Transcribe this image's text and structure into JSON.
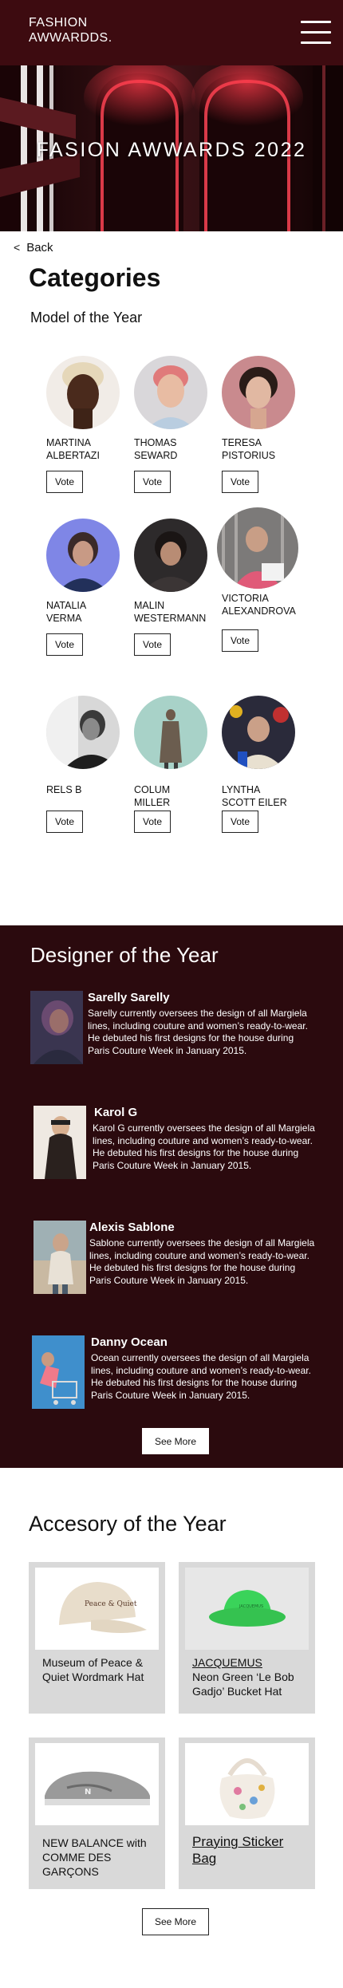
{
  "brand": {
    "line1": "FASHION",
    "line2": "AWWARDDS."
  },
  "hero": {
    "title": "FASION AWWARDS 2022"
  },
  "nav": {
    "back_label": "Back"
  },
  "page": {
    "title": "Categories"
  },
  "models": {
    "heading": "Model of the Year",
    "vote_label": "Vote",
    "items": [
      {
        "name": "MARTINA\nALBERTAZI"
      },
      {
        "name": "THOMAS\nSEWARD"
      },
      {
        "name": "TERESA\nPISTORIUS"
      },
      {
        "name": "NATALIA\nVERMA"
      },
      {
        "name": "MALIN\nWESTERMANN"
      },
      {
        "name": "VICTORIA\nALEXANDROVA"
      },
      {
        "name": "RELS B"
      },
      {
        "name": "COLUM\nMILLER"
      },
      {
        "name": "LYNTHA\nSCOTT EILER"
      }
    ]
  },
  "designers": {
    "heading": "Designer of the Year",
    "see_more": "See More",
    "items": [
      {
        "name": "Sarelly Sarelly",
        "desc": "Sarelly currently oversees the design of all Margiela lines, including couture and women’s ready-to-wear. He debuted his first designs for the house during Paris Couture Week in January 2015."
      },
      {
        "name": "Karol G",
        "desc": "Karol G currently oversees the design of all Margiela lines, including couture and women’s ready-to-wear. He debuted his first designs for the house during Paris Couture Week in January 2015."
      },
      {
        "name": "Alexis Sablone",
        "desc": "Sablone currently oversees the design of all Margiela lines, including couture and women’s ready-to-wear. He debuted his first designs for the house during Paris Couture Week in January 2015."
      },
      {
        "name": "Danny Ocean",
        "desc": "Ocean currently oversees the design of all Margiela lines, including couture and women’s ready-to-wear. He debuted his first designs for the house during Paris Couture Week in January 2015."
      }
    ]
  },
  "accessories": {
    "heading": "Accesory of the Year",
    "see_more": "See More",
    "items": [
      {
        "label": "Museum of Peace & Quiet Wordmark Hat"
      },
      {
        "brand": "JACQUEMUS",
        "label": "Neon Green ‘Le Bob Gadjo’ Bucket Hat"
      },
      {
        "label": "NEW BALANCE with COMME DES GARÇONS"
      },
      {
        "label": "Praying Sticker Bag"
      }
    ]
  },
  "colors": {
    "header_bg": "#3d0b10",
    "designer_bg": "#2b0a0e",
    "card_bg": "#d9d9d9"
  }
}
